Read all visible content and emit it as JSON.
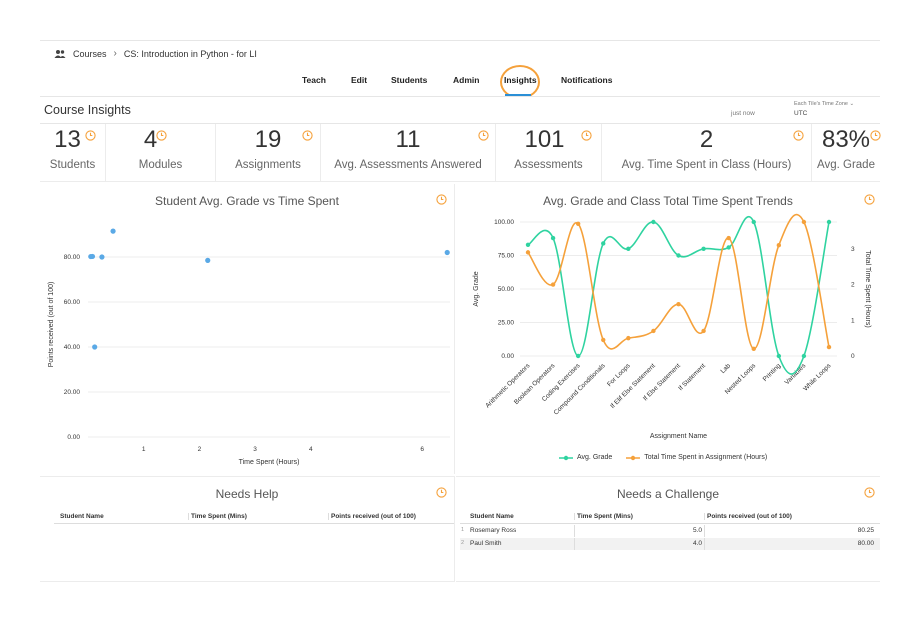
{
  "breadcrumb": {
    "root": "Courses",
    "separator": "›",
    "course": "CS: Introduction in Python - for LI"
  },
  "tabs": [
    {
      "label": "Teach"
    },
    {
      "label": "Edit"
    },
    {
      "label": "Students"
    },
    {
      "label": "Admin"
    },
    {
      "label": "Insights",
      "active": true
    },
    {
      "label": "Notifications"
    }
  ],
  "header": {
    "title": "Course Insights",
    "updated": "just now",
    "tz_label": "Each Tile's Time Zone",
    "tz_value": "UTC"
  },
  "stats": [
    {
      "value": "13",
      "label": "Students"
    },
    {
      "value": "4",
      "label": "Modules"
    },
    {
      "value": "19",
      "label": "Assignments"
    },
    {
      "value": "11",
      "label": "Avg. Assessments Answered"
    },
    {
      "value": "101",
      "label": "Assessments"
    },
    {
      "value": "2",
      "label": "Avg. Time Spent in Class (Hours)"
    },
    {
      "value": "83%",
      "label": "Avg. Grade"
    }
  ],
  "colors": {
    "accent_orange": "#f5a13b",
    "green": "#2fd3a0",
    "orange": "#f5a13b",
    "blue_point": "#5aa9e6",
    "active_tab": "#2b8fd6"
  },
  "chart_data": [
    {
      "type": "scatter",
      "title": "Student Avg. Grade vs Time Spent",
      "xlabel": "Time Spent (Hours)",
      "ylabel": "Points received (out of 100)",
      "xticks": [
        "1",
        "2",
        "3",
        "4",
        "6"
      ],
      "yticks": [
        "0.00",
        "20.00",
        "40.00",
        "60.00",
        "80.00"
      ],
      "xlim": [
        0,
        6.5
      ],
      "ylim": [
        0,
        100
      ],
      "points": [
        {
          "x": 0.05,
          "y": 80.2
        },
        {
          "x": 0.08,
          "y": 80.25
        },
        {
          "x": 0.12,
          "y": 40
        },
        {
          "x": 0.25,
          "y": 80
        },
        {
          "x": 0.45,
          "y": 91.5
        },
        {
          "x": 2.15,
          "y": 78.5
        },
        {
          "x": 6.45,
          "y": 82
        }
      ]
    },
    {
      "type": "line",
      "title": "Avg. Grade and Class Total Time Spent Trends",
      "xlabel": "Assignment Name",
      "ylabel": "Avg. Grade",
      "y2label": "Total Time Spent (Hours)",
      "yticks": [
        "0.00",
        "25.00",
        "50.00",
        "75.00",
        "100.00"
      ],
      "y2ticks": [
        "0",
        "1",
        "2",
        "3"
      ],
      "ylim": [
        0,
        100
      ],
      "y2lim": [
        0,
        3.75
      ],
      "categories": [
        "Arithmetic Operators",
        "Boolean Operators",
        "Coding Exercises",
        "Compound Conditionals",
        "For Loops",
        "If Elif Else Statement",
        "If Else Statement",
        "If Statement",
        "Lab",
        "Nested Loops",
        "Printing",
        "Variables",
        "While Loops"
      ],
      "series": [
        {
          "name": "Avg. Grade",
          "axis": "left",
          "values": [
            83,
            88,
            0,
            84,
            80,
            100,
            75,
            80,
            81,
            100,
            0,
            0,
            100
          ]
        },
        {
          "name": "Total Time Spent in Assignment (Hours)",
          "axis": "right",
          "values": [
            2.9,
            2.0,
            3.7,
            0.45,
            0.5,
            0.7,
            1.45,
            0.7,
            3.3,
            0.2,
            3.1,
            3.75,
            0.25
          ]
        }
      ]
    }
  ],
  "needs_help": {
    "title": "Needs Help",
    "columns": [
      "Student Name",
      "Time Spent (Mins)",
      "Points received (out of 100)"
    ],
    "rows": []
  },
  "needs_challenge": {
    "title": "Needs a Challenge",
    "columns": [
      "Student Name",
      "Time Spent (Mins)",
      "Points received (out of 100)"
    ],
    "rows": [
      {
        "index": "1",
        "name": "Rosemary Ross",
        "time": "5.0",
        "points": "80.25"
      },
      {
        "index": "2",
        "name": "Paul Smith",
        "time": "4.0",
        "points": "80.00"
      }
    ]
  }
}
